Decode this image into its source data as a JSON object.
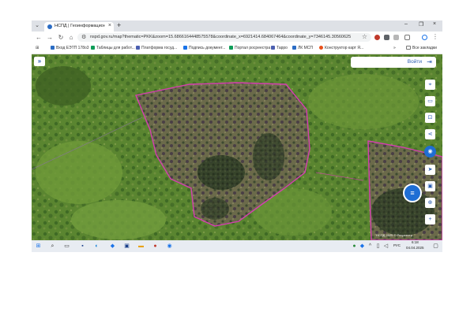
{
  "browser": {
    "tab_title": "НСПД | Геоинформационный...",
    "tab_close": "×",
    "new_tab": "+",
    "minimize": "–",
    "restore": "❐",
    "close": "×",
    "url": "nspd.gov.ru/map?thematic=PKK&zoom=15.6866164448575578&coordinate_x=6921414.684067464&coordinate_y=7346145.3056062598&the...",
    "icons": [
      "back-icon",
      "forward-icon",
      "reload-icon",
      "home-icon",
      "site-info-icon",
      "star-icon",
      "profile-icon",
      "menu-icon"
    ]
  },
  "bookmarks": {
    "items": [
      {
        "label": "Вход ЕЭТП 178о3",
        "color": "#2b6cc4"
      },
      {
        "label": "Таблицы для работ...",
        "color": "#0f9d58"
      },
      {
        "label": "Платформа госуд...",
        "color": "#4b5fb0"
      },
      {
        "label": "Подпись документ...",
        "color": "#1a73e8"
      },
      {
        "label": "Портал росреестра",
        "color": "#0f9d58"
      },
      {
        "label": "Тарро",
        "color": "#4b5fb0"
      },
      {
        "label": "ЛК МСП",
        "color": "#2b6cc4"
      },
      {
        "label": "Конструктор карт Я...",
        "color": "#e8501a"
      }
    ],
    "more": "»",
    "all_bookmarks": "Все закладки"
  },
  "map": {
    "layers_button": "»",
    "login_label": "Войти",
    "login_icon": "⇥",
    "tools": [
      "⌖",
      "▭",
      "⊡",
      "⋖",
      "◉",
      "➤",
      "▣",
      "⊕",
      "+"
    ],
    "fab_icon": "≡",
    "attribution": "НСПД 2025 © Росреестр",
    "colors": {
      "parcel_border": "#d53fb0",
      "parcel_fill": "#6b3a6e",
      "accent": "#1f6ed4"
    }
  },
  "taskbar": {
    "lang": "РУС",
    "time": "6:18",
    "date": "04.04.2025"
  }
}
